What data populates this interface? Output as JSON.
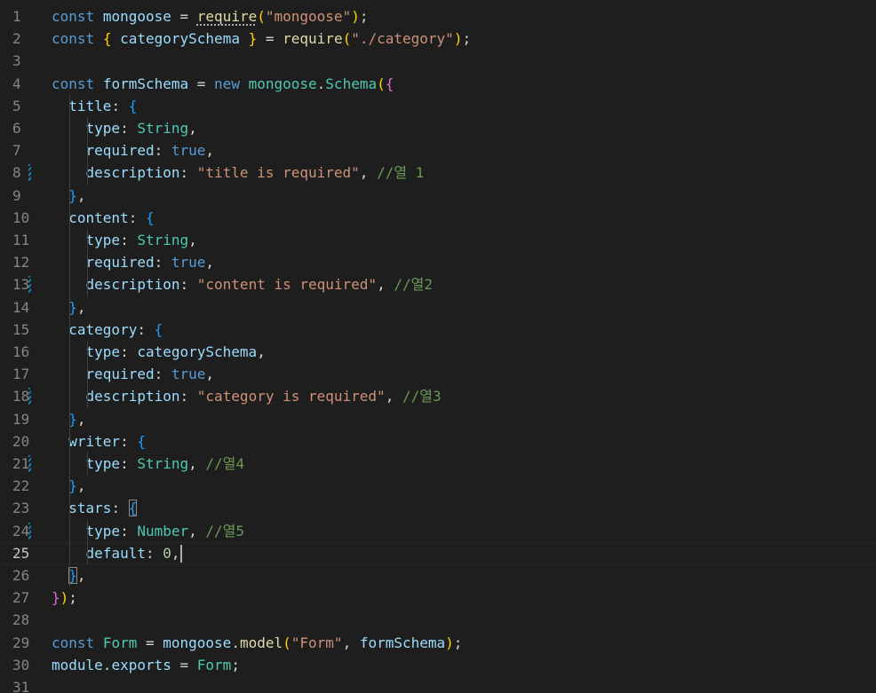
{
  "editor": {
    "language": "javascript",
    "current_line": 25,
    "lines": [
      {
        "n": "1",
        "dirty": false,
        "tokens": [
          [
            "k",
            "const"
          ],
          [
            "p",
            " "
          ],
          [
            "v",
            "mongoose"
          ],
          [
            "p",
            " = "
          ],
          [
            "f",
            "require",
            "sq"
          ],
          [
            "b1",
            "("
          ],
          [
            "s",
            "\"mongoose\""
          ],
          [
            "b1",
            ")"
          ],
          [
            "p",
            ";"
          ]
        ]
      },
      {
        "n": "2",
        "dirty": false,
        "tokens": [
          [
            "k",
            "const"
          ],
          [
            "p",
            " "
          ],
          [
            "b1",
            "{"
          ],
          [
            "p",
            " "
          ],
          [
            "v",
            "categorySchema"
          ],
          [
            "p",
            " "
          ],
          [
            "b1",
            "}"
          ],
          [
            "p",
            " = "
          ],
          [
            "f",
            "require"
          ],
          [
            "b1",
            "("
          ],
          [
            "s",
            "\"./category\""
          ],
          [
            "b1",
            ")"
          ],
          [
            "p",
            ";"
          ]
        ]
      },
      {
        "n": "3",
        "dirty": false,
        "tokens": []
      },
      {
        "n": "4",
        "dirty": false,
        "tokens": [
          [
            "k",
            "const"
          ],
          [
            "p",
            " "
          ],
          [
            "v",
            "formSchema"
          ],
          [
            "p",
            " = "
          ],
          [
            "k",
            "new"
          ],
          [
            "p",
            " "
          ],
          [
            "c",
            "mongoose"
          ],
          [
            "p",
            "."
          ],
          [
            "c",
            "Schema"
          ],
          [
            "b1",
            "("
          ],
          [
            "b2",
            "{"
          ]
        ]
      },
      {
        "n": "5",
        "dirty": false,
        "tokens": [
          [
            "p",
            "  "
          ],
          [
            "v",
            "title"
          ],
          [
            "p",
            ": "
          ],
          [
            "b3",
            "{"
          ]
        ]
      },
      {
        "n": "6",
        "dirty": false,
        "tokens": [
          [
            "p",
            "    "
          ],
          [
            "v",
            "type"
          ],
          [
            "p",
            ": "
          ],
          [
            "c",
            "String"
          ],
          [
            "p",
            ","
          ]
        ]
      },
      {
        "n": "7",
        "dirty": false,
        "tokens": [
          [
            "p",
            "    "
          ],
          [
            "v",
            "required"
          ],
          [
            "p",
            ": "
          ],
          [
            "k",
            "true"
          ],
          [
            "p",
            ","
          ]
        ]
      },
      {
        "n": "8",
        "dirty": true,
        "tokens": [
          [
            "p",
            "    "
          ],
          [
            "v",
            "description"
          ],
          [
            "p",
            ": "
          ],
          [
            "s",
            "\"title is required\""
          ],
          [
            "p",
            ", "
          ],
          [
            "cm",
            "//열 1"
          ]
        ]
      },
      {
        "n": "9",
        "dirty": false,
        "tokens": [
          [
            "p",
            "  "
          ],
          [
            "b3",
            "}"
          ],
          [
            "p",
            ","
          ]
        ]
      },
      {
        "n": "10",
        "dirty": false,
        "tokens": [
          [
            "p",
            "  "
          ],
          [
            "v",
            "content"
          ],
          [
            "p",
            ": "
          ],
          [
            "b3",
            "{"
          ]
        ]
      },
      {
        "n": "11",
        "dirty": false,
        "tokens": [
          [
            "p",
            "    "
          ],
          [
            "v",
            "type"
          ],
          [
            "p",
            ": "
          ],
          [
            "c",
            "String"
          ],
          [
            "p",
            ","
          ]
        ]
      },
      {
        "n": "12",
        "dirty": false,
        "tokens": [
          [
            "p",
            "    "
          ],
          [
            "v",
            "required"
          ],
          [
            "p",
            ": "
          ],
          [
            "k",
            "true"
          ],
          [
            "p",
            ","
          ]
        ]
      },
      {
        "n": "13",
        "dirty": true,
        "tokens": [
          [
            "p",
            "    "
          ],
          [
            "v",
            "description"
          ],
          [
            "p",
            ": "
          ],
          [
            "s",
            "\"content is required\""
          ],
          [
            "p",
            ", "
          ],
          [
            "cm",
            "//열2"
          ]
        ]
      },
      {
        "n": "14",
        "dirty": false,
        "tokens": [
          [
            "p",
            "  "
          ],
          [
            "b3",
            "}"
          ],
          [
            "p",
            ","
          ]
        ]
      },
      {
        "n": "15",
        "dirty": false,
        "tokens": [
          [
            "p",
            "  "
          ],
          [
            "v",
            "category"
          ],
          [
            "p",
            ": "
          ],
          [
            "b3",
            "{"
          ]
        ]
      },
      {
        "n": "16",
        "dirty": false,
        "tokens": [
          [
            "p",
            "    "
          ],
          [
            "v",
            "type"
          ],
          [
            "p",
            ": "
          ],
          [
            "v",
            "categorySchema"
          ],
          [
            "p",
            ","
          ]
        ]
      },
      {
        "n": "17",
        "dirty": false,
        "tokens": [
          [
            "p",
            "    "
          ],
          [
            "v",
            "required"
          ],
          [
            "p",
            ": "
          ],
          [
            "k",
            "true"
          ],
          [
            "p",
            ","
          ]
        ]
      },
      {
        "n": "18",
        "dirty": true,
        "tokens": [
          [
            "p",
            "    "
          ],
          [
            "v",
            "description"
          ],
          [
            "p",
            ": "
          ],
          [
            "s",
            "\"category is required\""
          ],
          [
            "p",
            ", "
          ],
          [
            "cm",
            "//열3"
          ]
        ]
      },
      {
        "n": "19",
        "dirty": false,
        "tokens": [
          [
            "p",
            "  "
          ],
          [
            "b3",
            "}"
          ],
          [
            "p",
            ","
          ]
        ]
      },
      {
        "n": "20",
        "dirty": false,
        "tokens": [
          [
            "p",
            "  "
          ],
          [
            "v",
            "writer"
          ],
          [
            "p",
            ": "
          ],
          [
            "b3",
            "{"
          ]
        ]
      },
      {
        "n": "21",
        "dirty": true,
        "tokens": [
          [
            "p",
            "    "
          ],
          [
            "v",
            "type"
          ],
          [
            "p",
            ": "
          ],
          [
            "c",
            "String"
          ],
          [
            "p",
            ", "
          ],
          [
            "cm",
            "//열4"
          ]
        ]
      },
      {
        "n": "22",
        "dirty": false,
        "tokens": [
          [
            "p",
            "  "
          ],
          [
            "b3",
            "}"
          ],
          [
            "p",
            ","
          ]
        ]
      },
      {
        "n": "23",
        "dirty": false,
        "tokens": [
          [
            "p",
            "  "
          ],
          [
            "v",
            "stars"
          ],
          [
            "p",
            ": "
          ],
          [
            "b3",
            "{",
            "bm"
          ]
        ]
      },
      {
        "n": "24",
        "dirty": true,
        "tokens": [
          [
            "p",
            "    "
          ],
          [
            "v",
            "type"
          ],
          [
            "p",
            ": "
          ],
          [
            "c",
            "Number"
          ],
          [
            "p",
            ", "
          ],
          [
            "cm",
            "//열5"
          ]
        ]
      },
      {
        "n": "25",
        "dirty": false,
        "tokens": [
          [
            "p",
            "    "
          ],
          [
            "v",
            "default"
          ],
          [
            "p",
            ": "
          ],
          [
            "n",
            "0"
          ],
          [
            "p",
            ","
          ]
        ],
        "cursor": true
      },
      {
        "n": "26",
        "dirty": false,
        "tokens": [
          [
            "p",
            "  "
          ],
          [
            "b3",
            "}",
            "bm"
          ],
          [
            "p",
            ","
          ]
        ]
      },
      {
        "n": "27",
        "dirty": false,
        "tokens": [
          [
            "b2",
            "}"
          ],
          [
            "b1",
            ")"
          ],
          [
            "p",
            ";"
          ]
        ]
      },
      {
        "n": "28",
        "dirty": false,
        "tokens": []
      },
      {
        "n": "29",
        "dirty": false,
        "tokens": [
          [
            "k",
            "const"
          ],
          [
            "p",
            " "
          ],
          [
            "c",
            "Form"
          ],
          [
            "p",
            " = "
          ],
          [
            "v",
            "mongoose"
          ],
          [
            "p",
            "."
          ],
          [
            "f",
            "model"
          ],
          [
            "b1",
            "("
          ],
          [
            "s",
            "\"Form\""
          ],
          [
            "p",
            ", "
          ],
          [
            "v",
            "formSchema"
          ],
          [
            "b1",
            ")"
          ],
          [
            "p",
            ";"
          ]
        ]
      },
      {
        "n": "30",
        "dirty": false,
        "tokens": [
          [
            "v",
            "module"
          ],
          [
            "p",
            "."
          ],
          [
            "v",
            "exports"
          ],
          [
            "p",
            " = "
          ],
          [
            "c",
            "Form"
          ],
          [
            "p",
            ";"
          ]
        ]
      },
      {
        "n": "31",
        "dirty": false,
        "tokens": []
      }
    ]
  }
}
